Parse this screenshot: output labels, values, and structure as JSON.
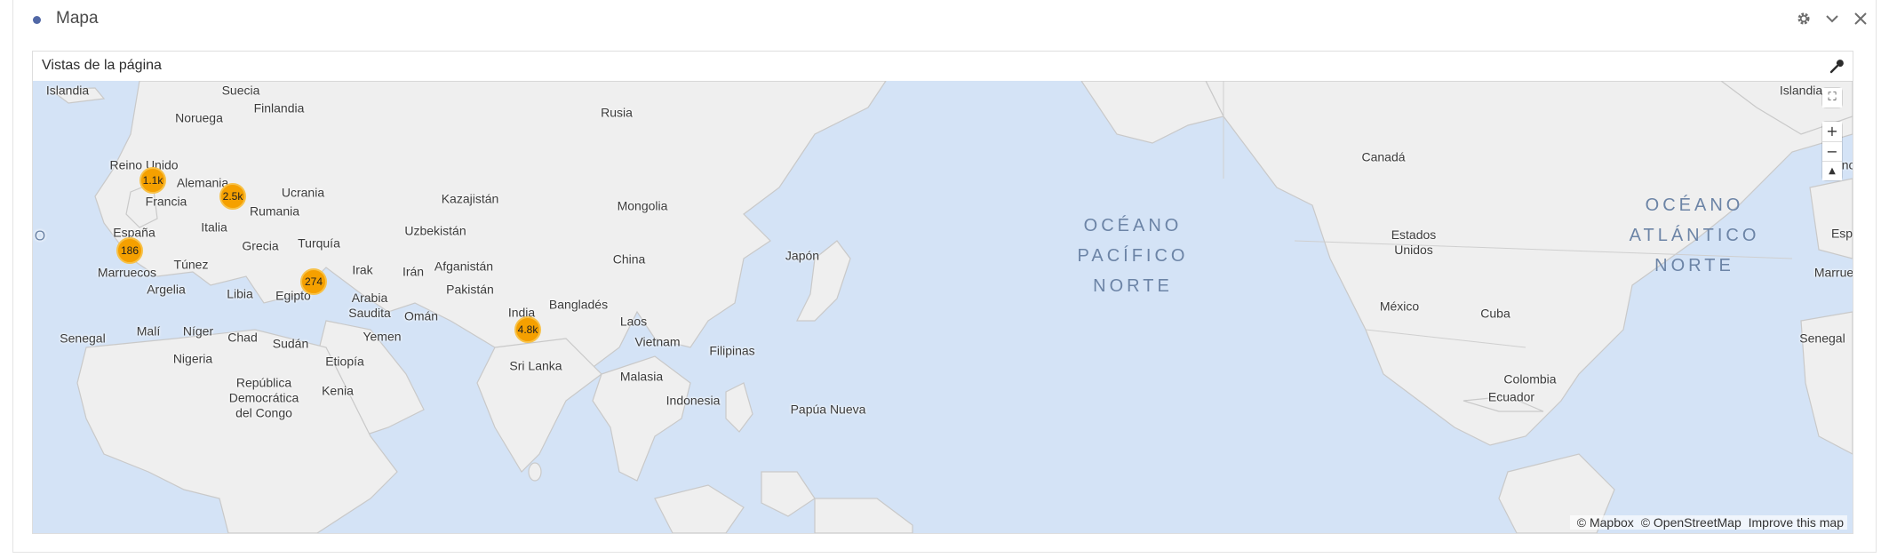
{
  "panel": {
    "title": "Mapa"
  },
  "viz": {
    "title": "Vistas de la página"
  },
  "map": {
    "labels": [
      {
        "id": "islandia-w",
        "text": "Islandia"
      },
      {
        "id": "suecia",
        "text": "Suecia"
      },
      {
        "id": "finlandia",
        "text": "Finlandia"
      },
      {
        "id": "noruega",
        "text": "Noruega"
      },
      {
        "id": "rusia",
        "text": "Rusia"
      },
      {
        "id": "reino-unido",
        "text": "Reino Unido"
      },
      {
        "id": "alemania",
        "text": "Alemania"
      },
      {
        "id": "ucrania",
        "text": "Ucrania"
      },
      {
        "id": "francia",
        "text": "Francia"
      },
      {
        "id": "rumania",
        "text": "Rumania"
      },
      {
        "id": "kazajistan",
        "text": "Kazajistán"
      },
      {
        "id": "mongolia",
        "text": "Mongolia"
      },
      {
        "id": "italia",
        "text": "Italia"
      },
      {
        "id": "espana",
        "text": "España"
      },
      {
        "id": "uzbekistan",
        "text": "Uzbekistán"
      },
      {
        "id": "grecia",
        "text": "Grecia"
      },
      {
        "id": "turquia",
        "text": "Turquía"
      },
      {
        "id": "o-left",
        "text": "O"
      },
      {
        "id": "china",
        "text": "China"
      },
      {
        "id": "japon",
        "text": "Japón"
      },
      {
        "id": "tunez",
        "text": "Túnez"
      },
      {
        "id": "irak",
        "text": "Irak"
      },
      {
        "id": "iran",
        "text": "Irán"
      },
      {
        "id": "afganistan",
        "text": "Afganistán"
      },
      {
        "id": "marruecos",
        "text": "Marruecos"
      },
      {
        "id": "argelia",
        "text": "Argelia"
      },
      {
        "id": "libia",
        "text": "Libia"
      },
      {
        "id": "egipto",
        "text": "Egipto"
      },
      {
        "id": "pakistan",
        "text": "Pakistán"
      },
      {
        "id": "arabia",
        "text": "Arabia\nSaudita"
      },
      {
        "id": "banglades",
        "text": "Bangladés"
      },
      {
        "id": "oman",
        "text": "Omán"
      },
      {
        "id": "india",
        "text": "India"
      },
      {
        "id": "laos",
        "text": "Laos"
      },
      {
        "id": "senegal-w",
        "text": "Senegal"
      },
      {
        "id": "mali",
        "text": "Malí"
      },
      {
        "id": "niger",
        "text": "Níger"
      },
      {
        "id": "chad",
        "text": "Chad"
      },
      {
        "id": "yemen",
        "text": "Yemen"
      },
      {
        "id": "sudan",
        "text": "Sudán"
      },
      {
        "id": "vietnam",
        "text": "Vietnam"
      },
      {
        "id": "filipinas",
        "text": "Filipinas"
      },
      {
        "id": "nigeria",
        "text": "Nigeria"
      },
      {
        "id": "etiopia",
        "text": "Etiopía"
      },
      {
        "id": "sri-lanka",
        "text": "Sri Lanka"
      },
      {
        "id": "malasia",
        "text": "Malasia"
      },
      {
        "id": "rdc",
        "text": "República\nDemocrática\ndel Congo"
      },
      {
        "id": "kenia",
        "text": "Kenia"
      },
      {
        "id": "indonesia",
        "text": "Indonesia"
      },
      {
        "id": "papua",
        "text": "Papúa Nueva"
      },
      {
        "id": "canada",
        "text": "Canadá"
      },
      {
        "id": "eeuu",
        "text": "Estados\nUnidos"
      },
      {
        "id": "mexico",
        "text": "México"
      },
      {
        "id": "cuba",
        "text": "Cuba"
      },
      {
        "id": "colombia",
        "text": "Colombia"
      },
      {
        "id": "ecuador",
        "text": "Ecuador"
      },
      {
        "id": "islandia-e",
        "text": "Islandia"
      },
      {
        "id": "reino-e",
        "text": "Reino"
      },
      {
        "id": "esp-e",
        "text": "Esp"
      },
      {
        "id": "marrue-e",
        "text": "Marrue"
      },
      {
        "id": "senegal-e",
        "text": "Senegal"
      }
    ],
    "oceans": [
      {
        "id": "pacifico",
        "text": "OCÉANO\nPACÍFICO\nNORTE"
      },
      {
        "id": "atlantico",
        "text": "OCÉANO\nATLÁNTICO\nNORTE"
      }
    ],
    "clusters": [
      {
        "id": "uk",
        "value": "1.1k"
      },
      {
        "id": "central-europe",
        "value": "2.5k"
      },
      {
        "id": "spain",
        "value": "186"
      },
      {
        "id": "israel",
        "value": "274"
      },
      {
        "id": "india",
        "value": "4.8k"
      }
    ],
    "controls": {
      "fullscreen": "⛶",
      "zoom_in": "+",
      "zoom_out": "−",
      "compass": "▲"
    },
    "attribution": {
      "mapbox": "© Mapbox",
      "osm": "© OpenStreetMap",
      "improve": "Improve this map"
    }
  }
}
